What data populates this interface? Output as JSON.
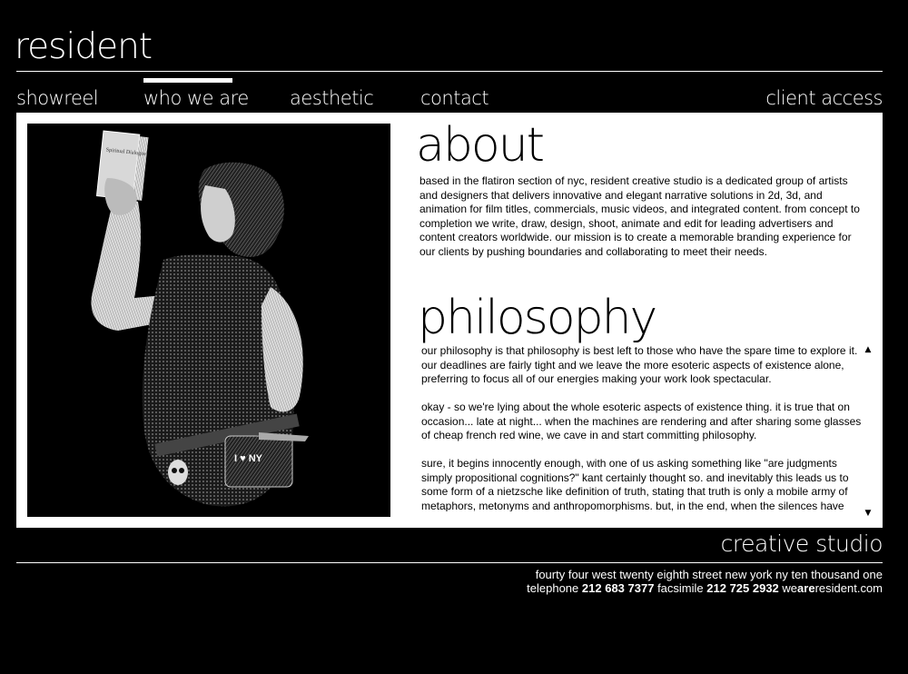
{
  "site": {
    "logo": "resident",
    "tagline": "creative studio"
  },
  "nav": {
    "items": [
      {
        "label": "showreel"
      },
      {
        "label": "who we are",
        "active": true
      },
      {
        "label": "aesthetic"
      },
      {
        "label": "contact"
      },
      {
        "label": "client access"
      }
    ]
  },
  "about": {
    "title": "about",
    "text": "based in the flatiron section of nyc, resident creative studio is a dedicated group of artists and designers that delivers innovative and elegant narrative solutions in 2d, 3d, and animation for film titles, commercials, music videos, and integrated content. from concept to completion we write, draw, design, shoot, animate and edit for leading advertisers and content creators worldwide. our mission is to create a memorable branding experience for our clients by pushing boundaries and collaborating to meet their needs."
  },
  "philosophy": {
    "title": "philosophy",
    "paragraphs": [
      "our philosophy is that philosophy is best left to those who have the spare time to explore it. our deadlines are fairly tight and we leave the more esoteric aspects of existence alone, preferring to focus all of our energies making your work look spectacular.",
      "okay - so we're lying about the whole esoteric aspects of existence thing. it is true that on occasion... late at night... when the machines are rendering and after sharing some glasses of cheap french red wine, we cave in and start committing philosophy.",
      "sure, it begins innocently enough, with one of us asking something like \"are judgments simply propositional cognitions?\" kant certainly thought so. and inevitably this leads us to some form of a nietzsche like definition of truth, stating that truth is only a mobile army of metaphors, metonyms and anthropomorphisms. but, in the end, when the silences have"
    ]
  },
  "photo": {
    "book_text": "Spiritual Dialogue",
    "bag_text": "I ♥ NY"
  },
  "footer": {
    "address": "fourty four west twenty eighth street new york ny ten thousand one",
    "telephone_label": "telephone",
    "telephone": "212 683 7377",
    "fax_label": "facsimile",
    "fax": "212 725 2932",
    "email_prefix": "we",
    "email_bold": "are",
    "email_suffix": "resident.com"
  },
  "colors": {
    "background": "#000000",
    "panel": "#ffffff",
    "text_light": "#ffffff",
    "text_dark": "#000000"
  }
}
